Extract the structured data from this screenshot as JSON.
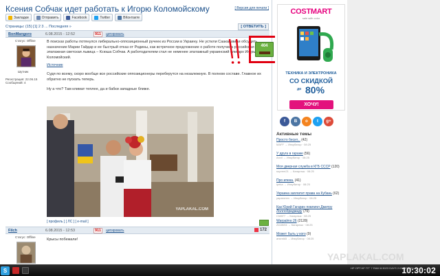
{
  "topic": {
    "title": "Ксения Собчак идет работать к Игорю Коломойскому",
    "top_links": "[ Версия для печати ]"
  },
  "share": [
    {
      "label": "Закладки",
      "icon": "bookmark-icon",
      "color": "#f2b400"
    },
    {
      "label": "Отправить",
      "icon": "mail-icon",
      "color": "#6a86b0"
    },
    {
      "label": "Facebook",
      "icon": "facebook-icon",
      "color": "#3b5998"
    },
    {
      "label": "Twitter",
      "icon": "twitter-icon",
      "color": "#1da1f2"
    },
    {
      "label": "ВКонтакте",
      "icon": "vk-icon",
      "color": "#4c75a3"
    }
  ],
  "pager": "Страницы: (15) [1] 2 3 ... Последняя »",
  "answer_button": "[ ОТВЕТИТЬ ]",
  "post1": {
    "author": "BonMangoro",
    "status": "Статус: Offline",
    "rank": "Шутник",
    "reg": "Регистрация: 22.06.15",
    "msgs": "Сообщений: 4",
    "date": "6.08.2015 - 12:52",
    "num": "911",
    "link1": "цитировать",
    "rating": "404",
    "p1": "В поисках работы потянулся либерально-оппозиционный ручеек из России в Украину. Не устили Саакашвили обсудить назначение Марии Гайдар и ее быстрый отказ от Родины, как встречное предложение о работе получила российская эпатажная светская львица – Ксюша Собчак. А работодателем стал не неменее эпатажный украинский олигарх Игорь Коломойский.",
    "source": "Источник",
    "p2": "Судя по всему, скоро вообще все российские оппозиционеры переберутся на незалежную. В полном составе. Главное их обратно не пускать теперь.",
    "p3": "Ну а что? Там климат теплее, да и бабки западные ближе.",
    "photo_watermark": "YAPLAKAL.COM",
    "photo_links": "[ профиль ]   [ ЛС ]   [ e-mail ]"
  },
  "post2": {
    "author": "Filch",
    "status": "Статус: Offline",
    "date": "6.08.2015 - 12:53",
    "num": "911",
    "link1": "цитировать",
    "rating": "172",
    "text": "Крысы побежали!"
  },
  "annotation": {
    "exclamation": "!!",
    "counter": "404"
  },
  "ad": {
    "logo": "COSTMART",
    "slogan": "sale with color",
    "line1": "ТЕХНИКА И ЭЛЕКТРОНИКА",
    "line2": "СО СКИДКОЙ",
    "line3": "до",
    "percent": "80%",
    "button": "ХОЧУ!"
  },
  "socials": [
    {
      "icon": "facebook-icon",
      "glyph": "f",
      "color": "#3b5998"
    },
    {
      "icon": "vk-icon",
      "glyph": "B",
      "color": "#4c75a3"
    },
    {
      "icon": "odnoklassniki-icon",
      "glyph": "o",
      "color": "#f48420"
    },
    {
      "icon": "twitter-icon",
      "glyph": "t",
      "color": "#1da1f2"
    },
    {
      "icon": "google-plus-icon",
      "glyph": "g+",
      "color": "#dd4b39"
    }
  ],
  "active_topics": {
    "title": "Активные темы",
    "items": [
      {
        "title": "Просто бесит...",
        "count": "(42)",
        "meta": "MAFF → Инкубатор · 08:25"
      },
      {
        "title": "У друга в гараже",
        "count": "(56)",
        "meta": "Anvil → Инкубатор · 08:25"
      },
      {
        "title": "Моя дверная служба в КГБ СССР",
        "count": "(120)",
        "meta": "suprem21 → Кагарлык · 08:25"
      },
      {
        "title": "Про ипека.",
        "count": "(41)",
        "meta": "ipeka → Инкубатор · 08:25"
      },
      {
        "title": "Украина заплатит права на Кубань",
        "count": "(62)",
        "meta": "yaparonen → Инкубатор · 08:25"
      },
      {
        "title": "Как Юрий Гагарин повлиял Дмитру Лоллобриджиду",
        "count": "(79)",
        "meta": "Chilli77 → Кагарлык · 08:25"
      },
      {
        "title": "Warpalmo 26",
        "count": "(2128)",
        "meta": "Zenith94 → Кагарлык · 08:25"
      },
      {
        "title": "Может быть у кого",
        "count": "(9)",
        "meta": "arsenik5 → Инкубатор · 08:25"
      }
    ]
  },
  "taskbar": {
    "start": "S",
    "tray": "HP    OPT.HF    ГГГ 7    RAM    8:3023   DAYS   2:03   69%  4%",
    "clock": "10:30:02",
    "watermark": "YAPLAKAL.COM"
  }
}
